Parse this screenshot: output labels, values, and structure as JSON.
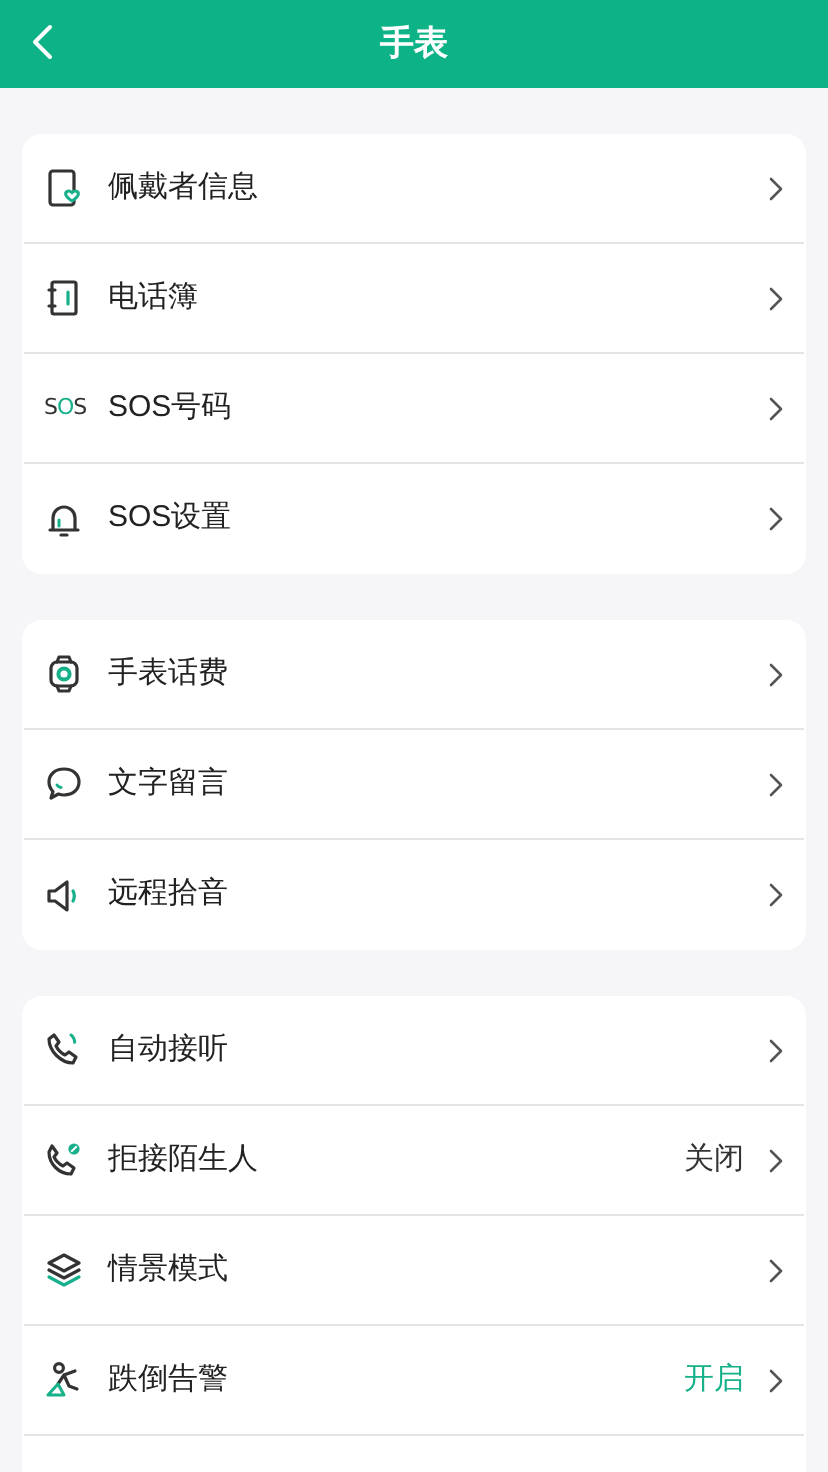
{
  "header": {
    "title": "手表"
  },
  "groups": [
    {
      "items": [
        {
          "label": "佩戴者信息"
        },
        {
          "label": "电话簿"
        },
        {
          "icon_text": "SOS",
          "label": "SOS号码"
        },
        {
          "label": "SOS设置"
        }
      ]
    },
    {
      "items": [
        {
          "label": "手表话费"
        },
        {
          "label": "文字留言"
        },
        {
          "label": "远程拾音"
        }
      ]
    },
    {
      "items": [
        {
          "label": "自动接听"
        },
        {
          "label": "拒接陌生人",
          "status": {
            "text": "关闭",
            "on": false
          }
        },
        {
          "label": "情景模式"
        },
        {
          "label": "跌倒告警",
          "status": {
            "text": "开启",
            "on": true
          }
        }
      ]
    }
  ]
}
